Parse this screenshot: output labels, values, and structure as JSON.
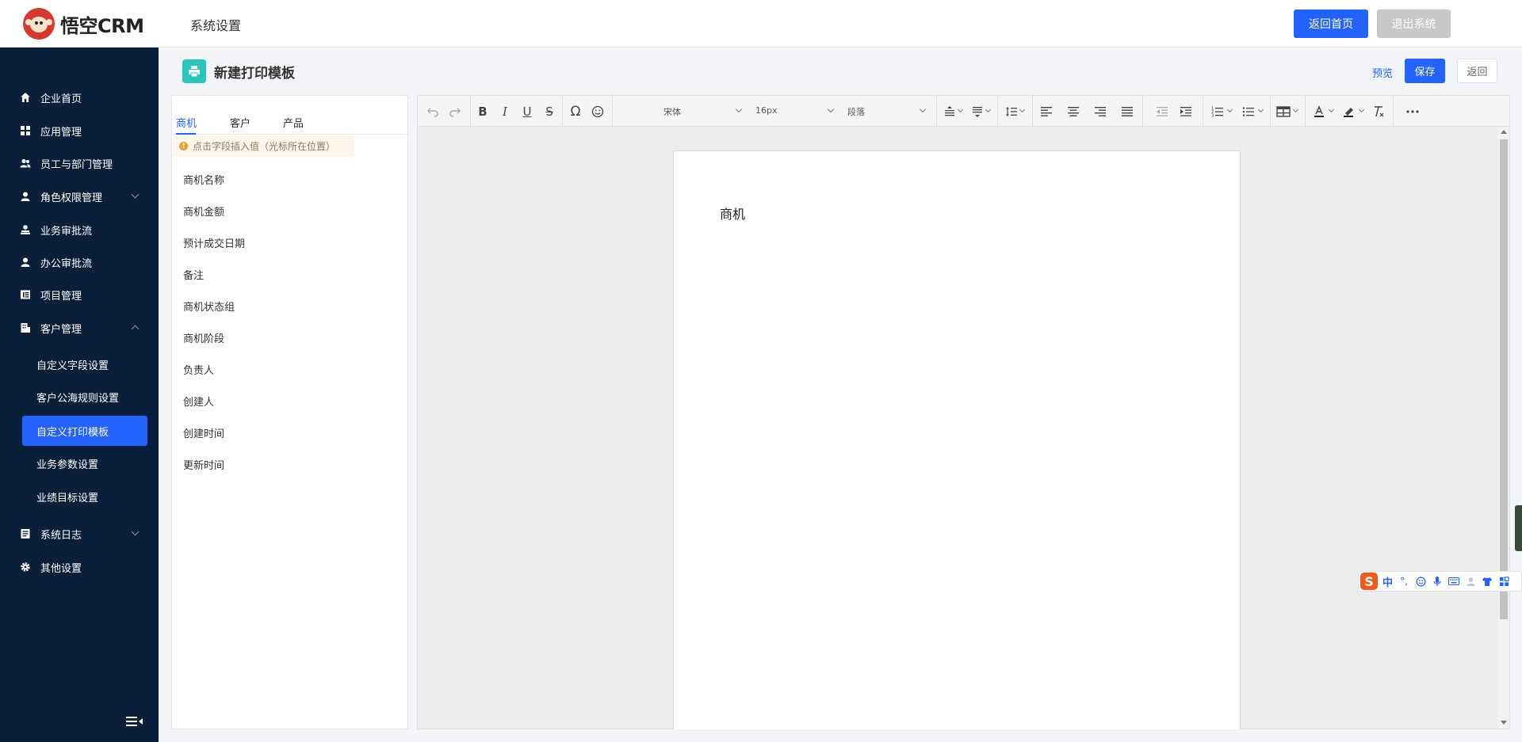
{
  "header": {
    "logo_text": "悟空CRM",
    "section_title": "系统设置",
    "home_button": "返回首页",
    "logout_button": "退出系统"
  },
  "sidebar": {
    "items": [
      {
        "label": "企业首页",
        "icon": "home-icon"
      },
      {
        "label": "应用管理",
        "icon": "grid-icon"
      },
      {
        "label": "员工与部门管理",
        "icon": "users-icon"
      },
      {
        "label": "角色权限管理",
        "icon": "user-icon",
        "expandable": true
      },
      {
        "label": "业务审批流",
        "icon": "approval-icon"
      },
      {
        "label": "办公审批流",
        "icon": "office-approval-icon"
      },
      {
        "label": "项目管理",
        "icon": "project-icon"
      },
      {
        "label": "客户管理",
        "icon": "customer-icon",
        "expanded": true
      },
      {
        "label": "系统日志",
        "icon": "log-icon",
        "expandable": true
      },
      {
        "label": "其他设置",
        "icon": "gear-icon"
      }
    ],
    "sub_items": [
      {
        "label": "自定义字段设置"
      },
      {
        "label": "客户公海规则设置"
      },
      {
        "label": "自定义打印模板",
        "active": true
      },
      {
        "label": "业务参数设置"
      },
      {
        "label": "业绩目标设置"
      }
    ]
  },
  "page": {
    "title": "新建打印模板",
    "preview_link": "预览",
    "save_button": "保存",
    "back_button": "返回"
  },
  "fields_panel": {
    "tabs": [
      "商机",
      "客户",
      "产品"
    ],
    "active_tab": "商机",
    "tip": "点击字段插入值（光标所在位置）",
    "fields": [
      "商机名称",
      "商机金额",
      "预计成交日期",
      "备注",
      "商机状态组",
      "商机阶段",
      "负责人",
      "创建人",
      "创建时间",
      "更新时间"
    ]
  },
  "editor": {
    "font_family": "宋体",
    "font_size": "16px",
    "block_format": "段落",
    "content": "商机"
  },
  "ime": {
    "mode": "中"
  },
  "colors": {
    "primary": "#2362fb",
    "sidebar_bg": "#0a1f39",
    "page_icon_bg": "#2cc5bd"
  }
}
